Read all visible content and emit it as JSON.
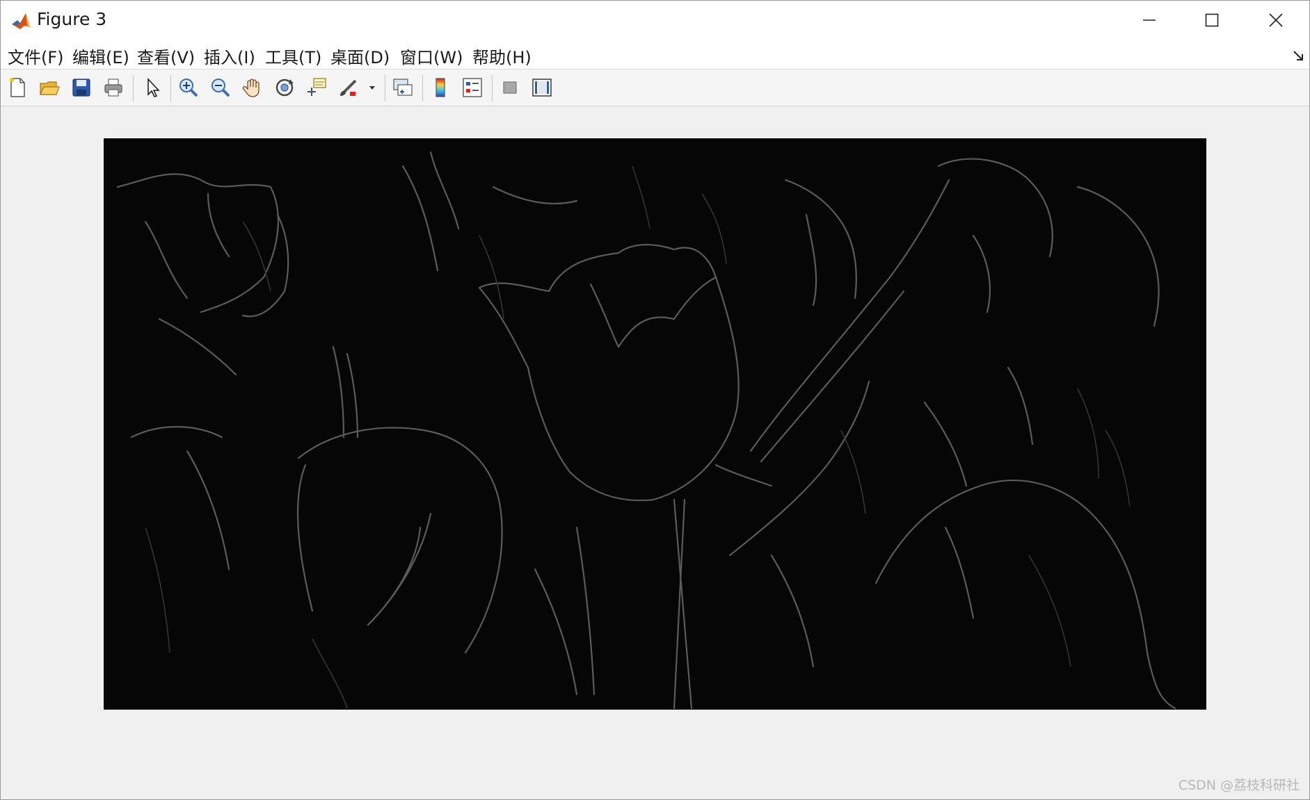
{
  "window": {
    "title": "Figure 3"
  },
  "menu": {
    "items": [
      {
        "label": "文件(F)"
      },
      {
        "label": "编辑(E)"
      },
      {
        "label": "查看(V)"
      },
      {
        "label": "插入(I)"
      },
      {
        "label": "工具(T)"
      },
      {
        "label": "桌面(D)"
      },
      {
        "label": "窗口(W)"
      },
      {
        "label": "帮助(H)"
      }
    ]
  },
  "toolbar": {
    "buttons": [
      {
        "icon": "new-figure-icon"
      },
      {
        "icon": "open-folder-icon"
      },
      {
        "icon": "save-icon"
      },
      {
        "icon": "print-icon"
      },
      {
        "icon": "pointer-icon"
      },
      {
        "icon": "zoom-in-icon"
      },
      {
        "icon": "zoom-out-icon"
      },
      {
        "icon": "pan-hand-icon"
      },
      {
        "icon": "rotate-3d-icon"
      },
      {
        "icon": "data-cursor-icon"
      },
      {
        "icon": "brush-icon"
      },
      {
        "icon": "link-plot-icon"
      },
      {
        "icon": "colorbar-icon"
      },
      {
        "icon": "legend-icon"
      },
      {
        "icon": "hide-plot-tools-icon"
      },
      {
        "icon": "show-plot-tools-icon"
      }
    ]
  },
  "figure": {
    "image_description": "edge-detected-tulips"
  },
  "watermark": "CSDN @荔枝科研社"
}
